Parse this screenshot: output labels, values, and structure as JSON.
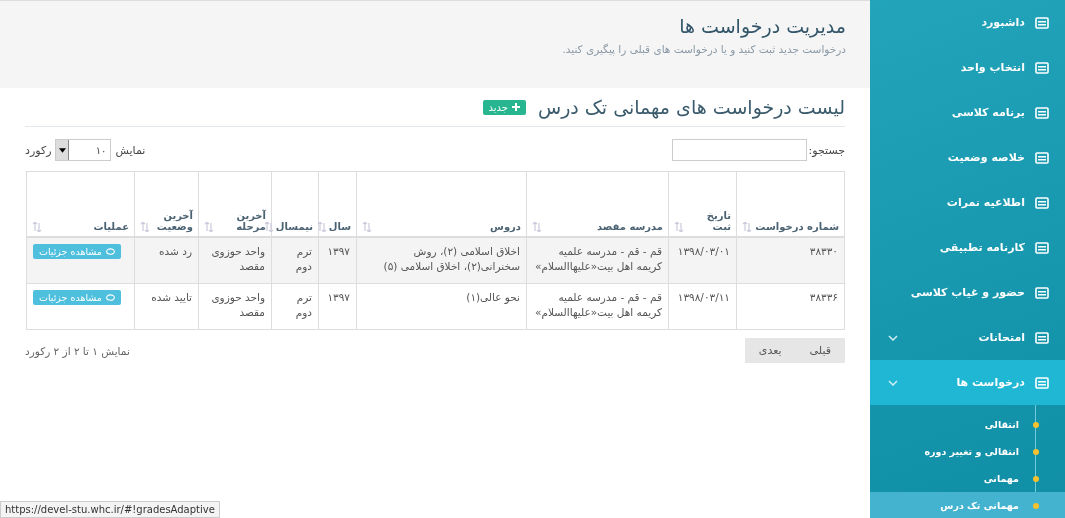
{
  "header": {
    "title": "مدیریت درخواست ها",
    "subtitle": "درخواست جدید ثبت کنید و یا درخواست های قبلی را پیگیری کنید."
  },
  "panel": {
    "title": "لیست درخواست های مهمانی تک درس",
    "new_button": "جدید"
  },
  "controls": {
    "search_label": "جستجو:",
    "show_label": "نمایش",
    "page_size": "۱۰",
    "records_label": "رکورد"
  },
  "table": {
    "columns": [
      "شماره درخواست",
      "تاریخ ثبت",
      "مدرسه مقصد",
      "دروس",
      "سال",
      "نیمسال",
      "آخرین مرحله",
      "آخرین وضعیت",
      "عملیات"
    ],
    "rows": [
      {
        "cells": [
          "۳۸۳۳۰",
          "۱۳۹۸/۰۳/۰۱",
          "قم - قم - مدرسه علمیه کریمه اهل بیت«علیهاالسلام»",
          "اخلاق اسلامی (۲)، روش سخنرانی(۲)، اخلاق اسلامی (۵)",
          "۱۳۹۷",
          "ترم دوم",
          "واحد حوزوی مقصد",
          "رد شده"
        ],
        "action": "مشاهده جزئیات"
      },
      {
        "cells": [
          "۳۸۳۳۶",
          "۱۳۹۸/۰۳/۱۱",
          "قم - قم - مدرسه علمیه کریمه اهل بیت«علیهاالسلام»",
          "نحو عالی(۱)",
          "۱۳۹۷",
          "ترم دوم",
          "واحد حوزوی مقصد",
          "تایید شده"
        ],
        "action": "مشاهده جزئیات"
      }
    ]
  },
  "footer": {
    "info": "نمایش ۱ تا ۲ از ۲ رکورد",
    "pagination": [
      {
        "label": "قبلی",
        "disabled": true
      },
      {
        "label": "بعدی",
        "disabled": true
      }
    ]
  },
  "sidebar": {
    "items": [
      {
        "label": "داشبورد",
        "selected": false
      },
      {
        "label": "انتخاب واحد",
        "selected": false
      },
      {
        "label": "برنامه کلاسی",
        "selected": false
      },
      {
        "label": "خلاصه وضعیت",
        "selected": false
      },
      {
        "label": "اطلاعیه نمرات",
        "selected": false
      },
      {
        "label": "کارنامه تطبیقی",
        "selected": false
      },
      {
        "label": "حضور و غیاب کلاسی",
        "selected": false
      },
      {
        "label": "امتحانات",
        "selected": false,
        "kind": "group"
      },
      {
        "label": "درخواست ها",
        "selected": true,
        "kind": "group",
        "expanded": true,
        "children": [
          {
            "label": "انتقالی",
            "selected": false
          },
          {
            "label": "انتقالی و تغییر دوره",
            "selected": false
          },
          {
            "label": "مهمانی",
            "selected": false
          },
          {
            "label": "مهمانی تک درس",
            "selected": true
          }
        ]
      }
    ]
  },
  "status_bar": {
    "url": "https://devel-stu.whc.ir/#!gradesAdaptive"
  }
}
